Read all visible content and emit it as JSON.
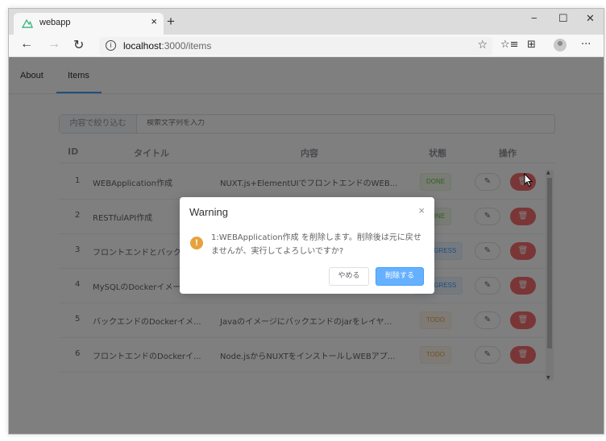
{
  "browser": {
    "tab_title": "webapp",
    "tab_close": "×",
    "new_tab": "+",
    "minimize": "−",
    "maximize": "☐",
    "close": "✕",
    "back": "←",
    "forward": "→",
    "refresh": "↻",
    "url_host": "localhost",
    "url_path": ":3000/items",
    "favorites_star": "☆",
    "favorites_list": "☆≡",
    "collections": "⊞",
    "more": "···",
    "favicon_color": "#41b883"
  },
  "nav": {
    "about_label": "About",
    "items_label": "Items"
  },
  "search": {
    "prepend_label": "内容で絞り込む",
    "placeholder": "検索文字列を入力"
  },
  "table": {
    "headers": {
      "id": "ID",
      "title": "タイトル",
      "content": "内容",
      "status": "状態",
      "actions": "操作"
    },
    "rows": [
      {
        "id": "1",
        "title": "WEBApplication作成",
        "content": "NUXT.js+ElementUIでフロントエンドのWEB...",
        "status": "DONE",
        "status_type": "done"
      },
      {
        "id": "2",
        "title": "RESTfulAPI作成",
        "content": "",
        "status": "DONE",
        "status_type": "done"
      },
      {
        "id": "3",
        "title": "フロントエンドとバック",
        "content": "",
        "status": "PROGRESS",
        "status_type": "progress"
      },
      {
        "id": "4",
        "title": "MySQLのDockerイメー",
        "content": "",
        "status": "PROGRESS",
        "status_type": "progress"
      },
      {
        "id": "5",
        "title": "バックエンドのDockerイメ...",
        "content": "Javaのイメージにバックエンドのjarをレイヤ...",
        "status": "TODO",
        "status_type": "todo"
      },
      {
        "id": "6",
        "title": "フロントエンドのDockerイ...",
        "content": "Node.jsからNUXTをインストールしWEBアプ...",
        "status": "TODO",
        "status_type": "todo"
      }
    ],
    "edit_icon": "✎",
    "delete_icon": "🗑"
  },
  "dialog": {
    "title": "Warning",
    "close_icon": "×",
    "warning_icon": "!",
    "message": "1:WEBApplication作成 を削除します。削除後は元に戻せませんが、実行してよろしいですか?",
    "cancel_label": "やめる",
    "confirm_label": "削除する"
  }
}
